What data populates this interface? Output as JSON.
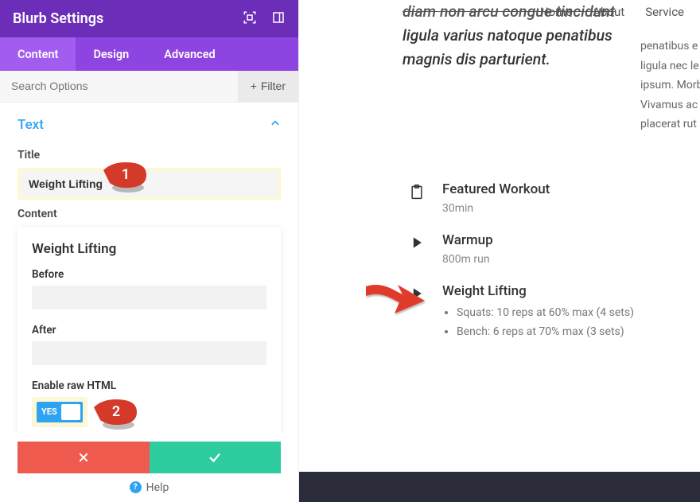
{
  "panel": {
    "title": "Blurb Settings",
    "tabs": [
      "Content",
      "Design",
      "Advanced"
    ],
    "active_tab": 0,
    "search_placeholder": "Search Options",
    "filter_label": "Filter",
    "section_title": "Text",
    "title_label": "Title",
    "title_value": "Weight Lifting",
    "content_label": "Content",
    "card": {
      "heading": "Weight Lifting",
      "before_label": "Before",
      "after_label": "After",
      "enable_raw_label": "Enable raw HTML",
      "toggle_text": "YES"
    },
    "help_label": "Help"
  },
  "nav": {
    "items": [
      "Home",
      "About",
      "Service"
    ]
  },
  "hero": {
    "line0": "diam non arcu congue tincidunt",
    "lines": "ligula varius natoque penatibus magnis dis parturient."
  },
  "side_lines": [
    "penatibus e",
    "ligula nec le",
    "ipsum. Morb",
    "Vivamus ac",
    "placerat rut"
  ],
  "workouts": [
    {
      "icon": "clipboard",
      "title": "Featured Workout",
      "meta": "30min"
    },
    {
      "icon": "play",
      "title": "Warmup",
      "meta": "800m run"
    },
    {
      "icon": "play",
      "title": "Weight Lifting",
      "bullets": [
        "Squats: 10 reps at 60% max (4 sets)",
        "Bench: 6 reps at 70% max (3 sets)"
      ]
    }
  ],
  "callouts": {
    "one": "1",
    "two": "2"
  }
}
